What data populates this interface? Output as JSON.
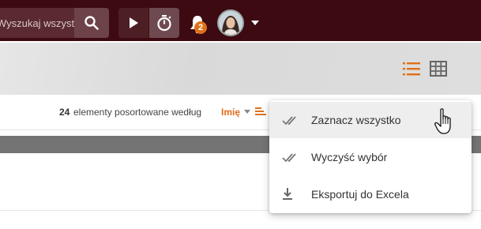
{
  "header": {
    "search": {
      "placeholder": "Wyszukaj wszystkiego..."
    },
    "notifications": {
      "count": "2"
    },
    "icons": [
      "search-icon",
      "play-icon",
      "stopwatch-icon",
      "bell-icon",
      "avatar",
      "chevron-down-icon"
    ]
  },
  "toolbar": {
    "views": [
      "list-view-icon",
      "grid-view-icon"
    ]
  },
  "sortbar": {
    "count": "24",
    "text": "elementy posortowane według",
    "field": "Imię"
  },
  "menu": {
    "items": [
      {
        "label": "Zaznacz wszystko",
        "icon": "check-all-icon"
      },
      {
        "label": "Wyczyść wybór",
        "icon": "check-all-icon"
      },
      {
        "label": "Eksportuj do Excela",
        "icon": "download-icon"
      }
    ]
  },
  "colors": {
    "topbar": "#3d0a12",
    "accent": "#e07018"
  }
}
